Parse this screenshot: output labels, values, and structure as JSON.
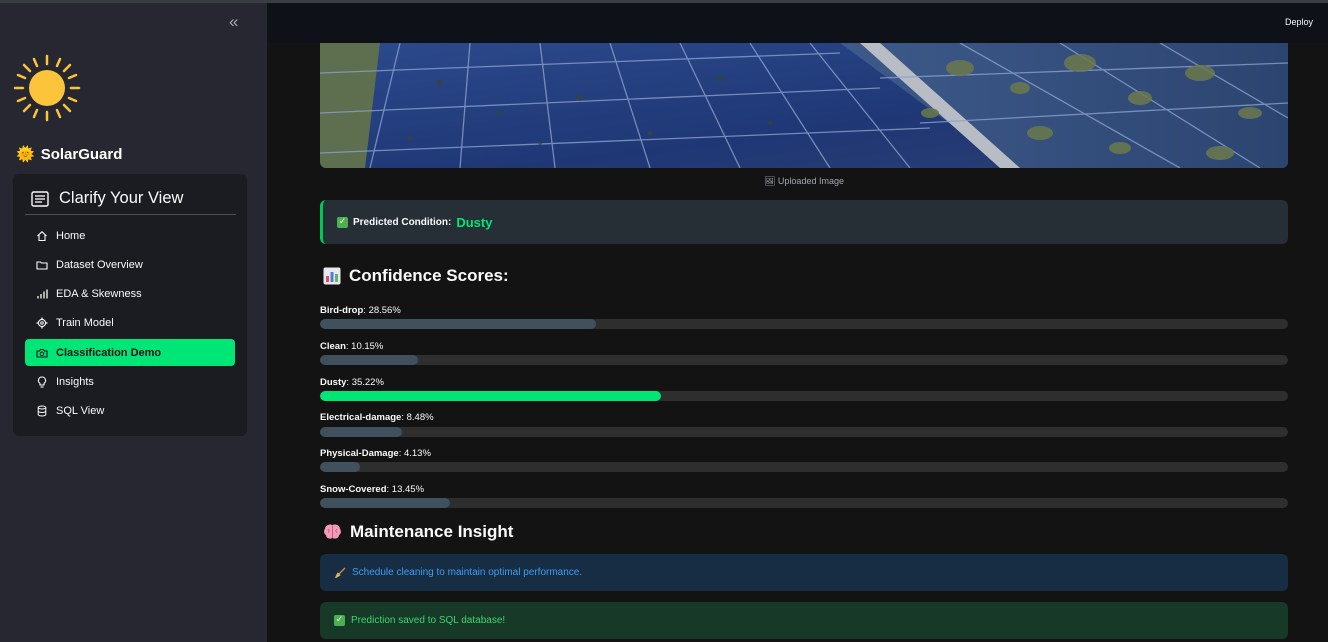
{
  "sidebar": {
    "brand": {
      "emoji": "🌞",
      "name": "SolarGuard"
    },
    "menu": {
      "title": "Clarify Your View",
      "items": [
        {
          "label": "Home",
          "icon": "house-icon",
          "active": false
        },
        {
          "label": "Dataset Overview",
          "icon": "folder-icon",
          "active": false
        },
        {
          "label": "EDA & Skewness",
          "icon": "bar-chart-icon",
          "active": false
        },
        {
          "label": "Train Model",
          "icon": "gear-icon",
          "active": false
        },
        {
          "label": "Classification Demo",
          "icon": "camera-icon",
          "active": true
        },
        {
          "label": "Insights",
          "icon": "lightbulb-icon",
          "active": false
        },
        {
          "label": "SQL View",
          "icon": "database-icon",
          "active": false
        }
      ]
    }
  },
  "header": {
    "deploy_label": "Deploy"
  },
  "main": {
    "image_caption": "🖼 Uploaded Image",
    "prediction": {
      "label": "Predicted Condition:",
      "value": "Dusty"
    },
    "confidence_title": "Confidence Scores:",
    "scores": [
      {
        "name": "Bird-drop",
        "text": "28.56%",
        "value": 28.56,
        "highlight": false
      },
      {
        "name": "Clean",
        "text": "10.15%",
        "value": 10.15,
        "highlight": false
      },
      {
        "name": "Dusty",
        "text": "35.22%",
        "value": 35.22,
        "highlight": true
      },
      {
        "name": "Electrical-damage",
        "text": "8.48%",
        "value": 8.48,
        "highlight": false
      },
      {
        "name": "Physical-Damage",
        "text": "4.13%",
        "value": 4.13,
        "highlight": false
      },
      {
        "name": "Snow-Covered",
        "text": "13.45%",
        "value": 13.45,
        "highlight": false
      }
    ],
    "maintenance_title": "Maintenance Insight",
    "insight_text": "Schedule cleaning to maintain optimal performance.",
    "success_text": "Prediction saved to SQL database!"
  },
  "colors": {
    "accent": "#00e676",
    "bar_default": "#41505d",
    "sidebar_bg": "#262730",
    "main_bg": "#131313"
  }
}
